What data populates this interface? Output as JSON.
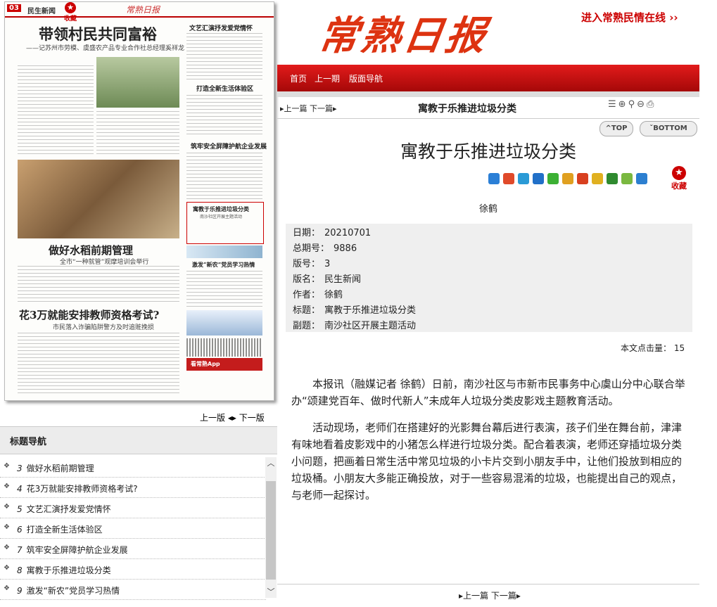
{
  "paper": {
    "page_num": "03",
    "section": "民生新闻",
    "fav": "收藏",
    "logo": "常熟日报",
    "headline": "带领村民共同富裕",
    "subhead": "——记苏州市劳模、虞盛农产品专业合作社总经理奚祥龙",
    "h_rice": "做好水稻前期管理",
    "h_rice_sub": "全市“一种就管”观摩培训会举行",
    "h_teacher": "花3万就能安排教师资格考试?",
    "h_teacher_sub": "市民落入诈骗陷阱警方及时追赃挽损",
    "h_culture": "文艺汇演抒发爱党情怀",
    "h_garbage": "打造全新生活体验区",
    "h_safety": "筑牢安全屏障护航企业发展",
    "box_title": "寓教于乐推进垃圾分类",
    "box_sub": "南沙社区开展主题活动",
    "h_party": "激发“新农”党员学习热情",
    "app": "看常熟App"
  },
  "pagenav": {
    "prev": "上一版",
    "next": "下一版"
  },
  "title_nav": {
    "header": "标题导航",
    "items": [
      {
        "num": "3",
        "label": "做好水稻前期管理"
      },
      {
        "num": "4",
        "label": "花3万就能安排教师资格考试?"
      },
      {
        "num": "5",
        "label": "文艺汇演抒发爱党情怀"
      },
      {
        "num": "6",
        "label": "打造全新生活体验区"
      },
      {
        "num": "7",
        "label": "筑牢安全屏障护航企业发展"
      },
      {
        "num": "8",
        "label": "寓教于乐推进垃圾分类"
      },
      {
        "num": "9",
        "label": "激发“新农”党员学习热情"
      }
    ]
  },
  "header": {
    "brand": "常熟日报",
    "enter_link": "进入常熟民情在线 ››",
    "menu": [
      "首页",
      "上一期",
      "版面导航"
    ]
  },
  "article": {
    "prev_next": "上一篇 下一篇",
    "bar_title": "寓教于乐推进垃圾分类",
    "top": "TOP",
    "bottom": "BOTTOM",
    "title": "寓教于乐推进垃圾分类",
    "fav": "收藏",
    "author": "徐鹤",
    "meta": [
      {
        "label": "日期：",
        "value": "20210701"
      },
      {
        "label": "总期号：",
        "value": "9886"
      },
      {
        "label": "版号：",
        "value": "3"
      },
      {
        "label": "版名：",
        "value": "民生新闻"
      },
      {
        "label": "作者：",
        "value": "徐鹤"
      },
      {
        "label": "标题：",
        "value": "寓教于乐推进垃圾分类"
      },
      {
        "label": "副题：",
        "value": "南沙社区开展主题活动"
      }
    ],
    "hits_label": "本文点击量：",
    "hits": "15",
    "paragraphs": [
      "本报讯（融媒记者 徐鹤）日前，南沙社区与市新市民事务中心虞山分中心联合举办“颂建党百年、做时代新人”未成年人垃圾分类皮影戏主题教育活动。",
      "活动现场，老师们在搭建好的光影舞台幕后进行表演，孩子们坐在舞台前，津津有味地看着皮影戏中的小猪怎么样进行垃圾分类。配合着表演，老师还穿插垃圾分类小问题，把画着日常生活中常见垃圾的小卡片交到小朋友手中，让他们投放到相应的垃圾桶。小朋友大多能正确投放，对于一些容易混淆的垃圾，也能提出自己的观点，与老师一起探讨。"
    ],
    "bottom_nav": "上一篇 下一篇"
  }
}
